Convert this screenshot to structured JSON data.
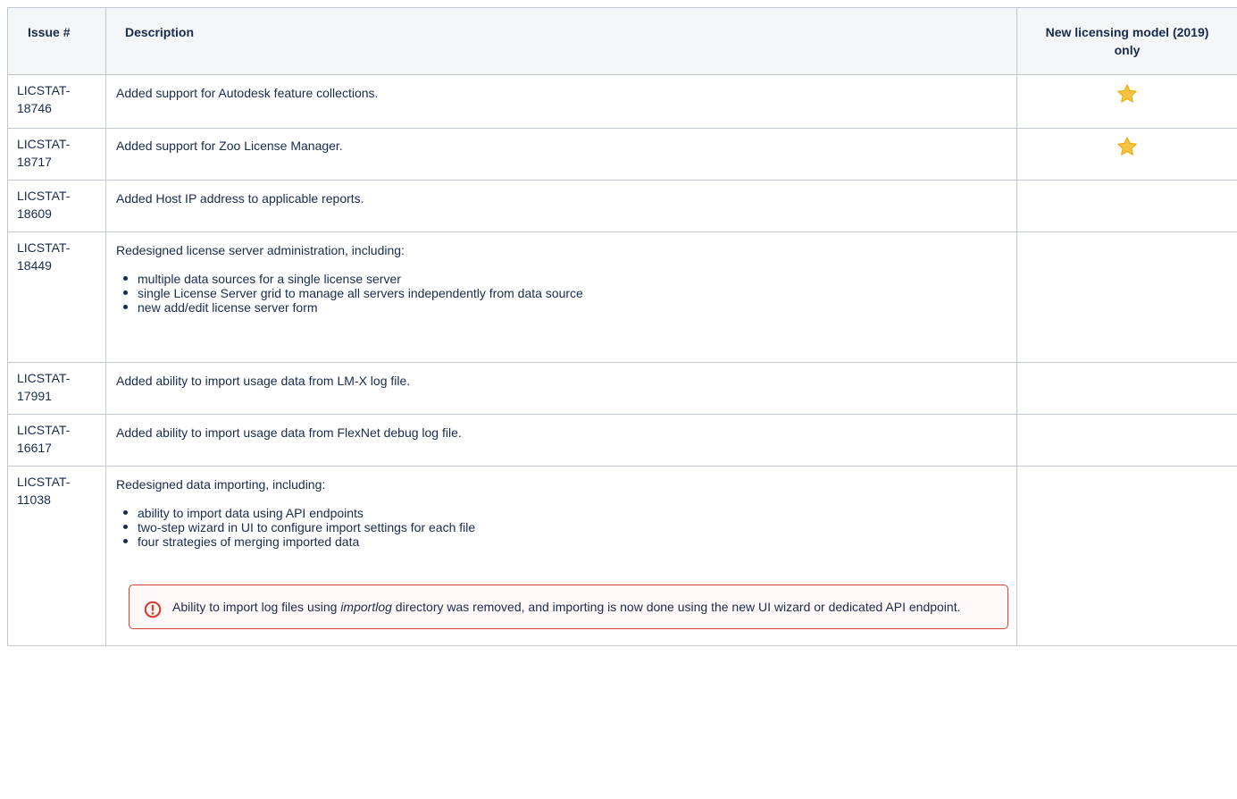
{
  "headers": {
    "issue": "Issue #",
    "description": "Description",
    "model": "New licensing model (2019) only"
  },
  "rows": [
    {
      "issue": "LICSTAT-18746",
      "description": "Added support for Autodesk feature collections.",
      "new_model_only": true
    },
    {
      "issue": "LICSTAT-18717",
      "description": "Added support for Zoo License Manager.",
      "new_model_only": true
    },
    {
      "issue": "LICSTAT-18609",
      "description": "Added Host IP address to applicable reports.",
      "new_model_only": false
    },
    {
      "issue": "LICSTAT-18449",
      "description": "Redesigned license server administration, including:",
      "bullets": [
        "multiple data sources for a single license server",
        "single License Server grid to manage all servers independently from data source",
        "new add/edit license server form"
      ],
      "new_model_only": false
    },
    {
      "issue": "LICSTAT-17991",
      "description": "Added ability to import usage data from LM-X log file.",
      "new_model_only": false
    },
    {
      "issue": "LICSTAT-16617",
      "description": "Added ability to import usage data from FlexNet debug log file.",
      "new_model_only": false
    },
    {
      "issue": "LICSTAT-11038",
      "description": "Redesigned data importing, including:",
      "bullets": [
        "ability to import data using API endpoints",
        "two-step wizard in UI to configure import settings for each file",
        "four strategies of merging imported data"
      ],
      "warning": {
        "before": "Ability to import log files using ",
        "emphasis": "importlog",
        "after": " directory was removed, and importing is now done using the new UI wizard or dedicated API endpoint."
      },
      "new_model_only": false
    }
  ],
  "colors": {
    "border": "#c1c7d0",
    "header_bg": "#f4f5f7",
    "warning_border": "#d04437",
    "warning_bg": "#fff8f7",
    "star": "#f6c342"
  },
  "icons": {
    "star": "star-icon",
    "warning": "exclamation-circle-icon"
  }
}
